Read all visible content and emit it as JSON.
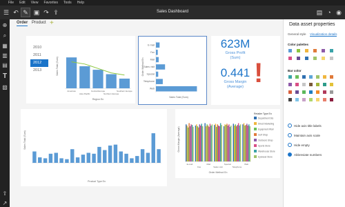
{
  "menu": [
    "File",
    "Edit",
    "View",
    "Favorites",
    "Tools",
    "Help"
  ],
  "toolbar": {
    "title": "Sales Dashboard"
  },
  "tabs": {
    "order": "Order",
    "product": "Product",
    "add": "+"
  },
  "years": [
    "2010",
    "2011",
    "2012",
    "2013"
  ],
  "selected_year": "2012",
  "kpis": [
    {
      "value": "623M",
      "label1": "Gross Profit",
      "label2": "(Sum)"
    },
    {
      "value": "0.441",
      "label1": "Gross Margin",
      "label2": "(Average)"
    }
  ],
  "exclaim": "!",
  "right_panel": {
    "title": "Data asset properties",
    "tab_general": "General style",
    "tab_visual": "Visualization details",
    "palettes_label": "Color palettes",
    "bar_color_label": "Bar color",
    "options": [
      {
        "label": "Hide axis title labels",
        "on": false
      },
      {
        "label": "Maintain axis scale",
        "on": false
      },
      {
        "label": "Hide empty",
        "on": false
      },
      {
        "label": "Abbreviate numbers",
        "on": true
      }
    ],
    "bar_colors": [
      "#3aa3a8",
      "#6bbf5a",
      "#2f6fb0",
      "#5fa6d8",
      "#9fc46a",
      "#f0b63e",
      "#e07a3a",
      "#8e5aa8",
      "#d94f86",
      "#c6c6c6",
      "#7a5a3a",
      "#a4b63a",
      "#2d9c8a",
      "#e3c238",
      "#d95f3d",
      "#6a4c93",
      "#5cb85c",
      "#1f7fbf",
      "#f28c28",
      "#b03a5b",
      "#9a9a9a",
      "#444444",
      "#7fc4e8",
      "#c8a2c8",
      "#b0d66b",
      "#f5d76e",
      "#e87e6b",
      "#8b1e3f"
    ]
  },
  "chart_data": [
    {
      "type": "bar",
      "title": "",
      "xlabel": "Region En",
      "ylabel": "Sales Total (Sum)",
      "categories": [
        "Americas",
        "Asia Pacific",
        "Central Europe",
        "Northern Europe",
        "Southern Europe"
      ],
      "values": [
        0.7,
        0.5,
        0.42,
        0.32,
        0.22
      ],
      "line_values": [
        0.6,
        0.55,
        0.45,
        0.35,
        0.3
      ],
      "ylim": [
        0,
        1
      ]
    },
    {
      "type": "bar",
      "orientation": "horizontal",
      "xlabel": "Sales Total (Sum)",
      "ylabel": "Order Method En",
      "categories": [
        "E-mail",
        "Fax",
        "Mail",
        "Sales visit",
        "Special",
        "Telephone",
        "Web"
      ],
      "values": [
        0.08,
        0.04,
        0.06,
        0.2,
        0.05,
        0.15,
        0.9
      ]
    },
    {
      "type": "bar",
      "xlabel": "Product Type En",
      "ylabel": "Sales Total (Sum)",
      "values": [
        0.25,
        0.12,
        0.1,
        0.2,
        0.22,
        0.1,
        0.08,
        0.3,
        0.12,
        0.18,
        0.22,
        0.2,
        0.35,
        0.28,
        0.38,
        0.4,
        0.25,
        0.2,
        0.1,
        0.15,
        0.3,
        0.22,
        0.65,
        0.3
      ]
    },
    {
      "type": "bar",
      "xlabel": "Order Method En",
      "ylabel": "Gross Margin (Average)",
      "legend_title": "Retailer Type En",
      "legend": [
        "Department Sto",
        "Direct Marketing",
        "Equipment Rtail",
        "Golf Shop",
        "Outdoors Shop",
        "Sports Store",
        "Warehouse Store",
        "Eyewear Store"
      ],
      "categories": [
        "E-mail",
        "Fax",
        "Mail",
        "Sales visit",
        "Special",
        "Telephone",
        "Web"
      ],
      "colors": [
        "#2f6fb0",
        "#f0b63e",
        "#6bbf5a",
        "#e07a3a",
        "#8e5aa8",
        "#d94f86",
        "#3aa3a8",
        "#9fc46a"
      ],
      "series_values": [
        [
          0.6,
          0.58,
          0.55,
          0.62,
          0.57,
          0.6,
          0.59,
          0.56
        ],
        [
          0.58,
          0.6,
          0.57,
          0.55,
          0.6,
          0.58,
          0.61,
          0.57
        ],
        [
          0.62,
          0.57,
          0.6,
          0.58,
          0.56,
          0.61,
          0.58,
          0.6
        ],
        [
          0.59,
          0.61,
          0.56,
          0.6,
          0.58,
          0.57,
          0.62,
          0.59
        ],
        [
          0.57,
          0.6,
          0.59,
          0.61,
          0.58,
          0.6,
          0.56,
          0.58
        ],
        [
          0.61,
          0.58,
          0.6,
          0.57,
          0.59,
          0.62,
          0.58,
          0.6
        ],
        [
          0.6,
          0.62,
          0.58,
          0.59,
          0.61,
          0.58,
          0.6,
          0.57
        ]
      ]
    }
  ]
}
